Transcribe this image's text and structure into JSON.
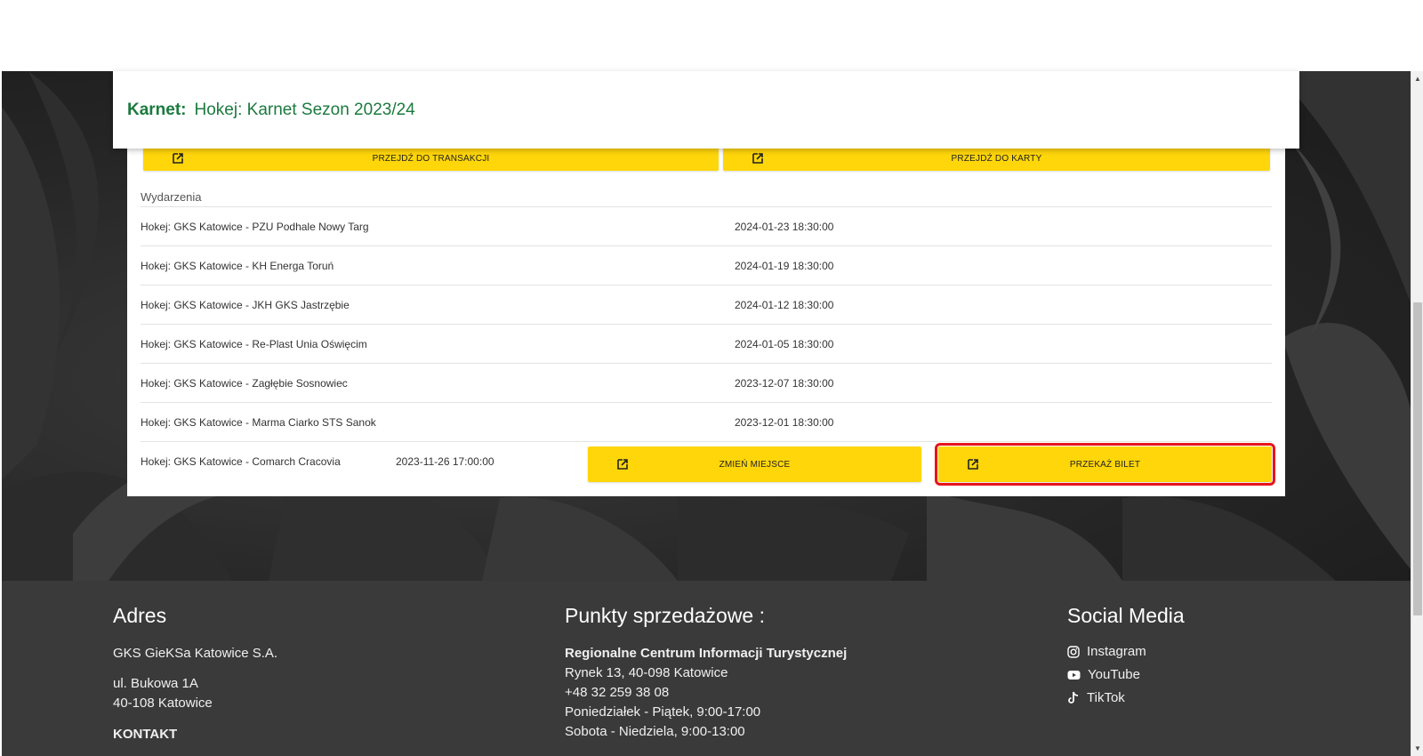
{
  "card": {
    "title_label": "Karnet:",
    "title_value": "Hokej: Karnet Sezon 2023/24"
  },
  "actions": {
    "transaction_label": "PRZEJDŹ DO TRANSAKCJI",
    "card_label": "PRZEJDŹ DO KARTY",
    "change_seat_label": "ZMIEŃ MIEJSCE",
    "transfer_ticket_label": "PRZEKAŻ BILET"
  },
  "events": {
    "heading": "Wydarzenia",
    "items": [
      {
        "name": "Hokej: GKS Katowice - PZU Podhale Nowy Targ",
        "date": "2024-01-23 18:30:00"
      },
      {
        "name": "Hokej: GKS Katowice - KH Energa Toruń",
        "date": "2024-01-19 18:30:00"
      },
      {
        "name": "Hokej: GKS Katowice - JKH GKS Jastrzębie",
        "date": "2024-01-12 18:30:00"
      },
      {
        "name": "Hokej: GKS Katowice - Re-Plast Unia Oświęcim",
        "date": "2024-01-05 18:30:00"
      },
      {
        "name": "Hokej: GKS Katowice - Zagłębie Sosnowiec",
        "date": "2023-12-07 18:30:00"
      },
      {
        "name": "Hokej: GKS Katowice - Marma Ciarko STS Sanok",
        "date": "2023-12-01 18:30:00"
      },
      {
        "name": "Hokej: GKS Katowice - Comarch Cracovia",
        "date": "2023-11-26 17:00:00"
      }
    ]
  },
  "footer": {
    "address": {
      "heading": "Adres",
      "company": "GKS GieKSa Katowice S.A.",
      "street": "ul. Bukowa 1A",
      "city": "40-108 Katowice",
      "contact_heading": "KONTAKT"
    },
    "sales": {
      "heading": "Punkty sprzedażowe :",
      "place": "Regionalne Centrum Informacji Turystycznej",
      "address": "Rynek 13, 40-098 Katowice",
      "phone": "+48 32 259 38 08",
      "hours_weekdays": "Poniedziałek - Piątek, 9:00-17:00",
      "hours_weekend": "Sobota - Niedziela, 9:00-13:00"
    },
    "social": {
      "heading": "Social Media",
      "instagram": "Instagram",
      "youtube": "YouTube",
      "tiktok": "TikTok"
    }
  },
  "colors": {
    "accent_yellow": "#ffd60a",
    "title_green": "#1b7a3e",
    "highlight_red": "#e8141c",
    "footer_bg": "#3a3a3a"
  }
}
